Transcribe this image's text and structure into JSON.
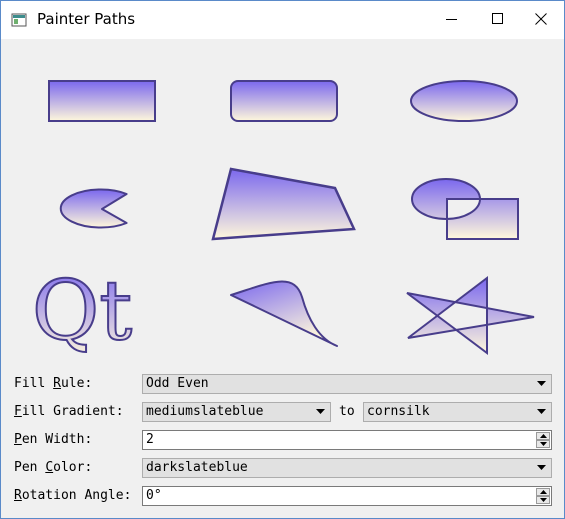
{
  "window": {
    "title": "Painter Paths",
    "icon": "qt-app-icon",
    "controls": [
      "minimize-icon",
      "maximize-icon",
      "close-icon"
    ]
  },
  "render": {
    "shapes": [
      "rectangle",
      "rounded-rectangle",
      "ellipse",
      "pie",
      "polygon",
      "group",
      "text",
      "bezier-curve",
      "star"
    ],
    "qt_text": "Qt",
    "fill_gradient_start": "#7b68ee",
    "fill_gradient_end": "#fff8dc",
    "pen_color": "#483d8b"
  },
  "controls": {
    "fill_rule": {
      "label_pre": "Fill ",
      "label_ul": "R",
      "label_post": "ule:",
      "value": "Odd Even"
    },
    "fill_gradient": {
      "label_pre": "",
      "label_ul": "F",
      "label_post": "ill Gradient:",
      "start": "mediumslateblue",
      "to_label": "to",
      "end": "cornsilk"
    },
    "pen_width": {
      "label_pre": "",
      "label_ul": "P",
      "label_post": "en Width:",
      "value": "2"
    },
    "pen_color": {
      "label_pre": "Pen ",
      "label_ul": "C",
      "label_post": "olor:",
      "value": "darkslateblue"
    },
    "rotation_angle": {
      "label_pre": "",
      "label_ul": "R",
      "label_post": "otation Angle:",
      "value": "0°"
    }
  }
}
